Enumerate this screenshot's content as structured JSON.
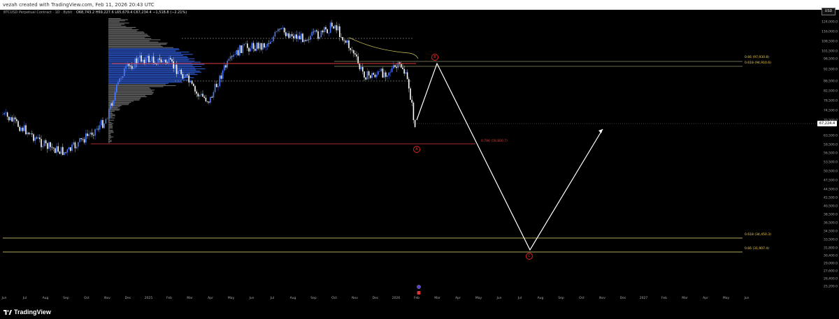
{
  "header": {
    "attribution": "vezah created with TradingView.com, Feb 11, 2026 20:43 UTC"
  },
  "symbol": {
    "name": "BTCUSD Perpetual Contract · 1D · Bybit",
    "ohlc": "O68,743.2 H69,227.6 L65,679.4 C67,234.4 −1,518.8 (−2.21%)"
  },
  "price_axis": {
    "currency": "USD",
    "current_price": "67,224.4",
    "ticks": [
      "124,000.0",
      "116,000.0",
      "108,500.0",
      "101,500.0",
      "98,500.0",
      "92,500.0",
      "86,500.0",
      "82,500.0",
      "78,500.0",
      "74,500.0",
      "70,500.0",
      "67,224.4",
      "63,500.0",
      "59,500.0",
      "56,500.0",
      "53,500.0",
      "50,500.0",
      "47,500.0",
      "44,500.0",
      "42,500.0",
      "40,500.0",
      "38,500.0",
      "36,500.0",
      "34,500.0",
      "33,500.0",
      "31,800.0",
      "30,400.0",
      "29,000.0",
      "27,600.0",
      "26,400.0",
      "25,200.0"
    ]
  },
  "time_axis": {
    "ticks": [
      "Jun",
      "Jul",
      "Aug",
      "Sep",
      "Oct",
      "Nov",
      "Dec",
      "2025",
      "Feb",
      "Mar",
      "Apr",
      "May",
      "Jun",
      "Jul",
      "Aug",
      "Sep",
      "Oct",
      "Nov",
      "Dec",
      "2026",
      "Feb",
      "Mar",
      "Apr",
      "May",
      "Jun",
      "Jul",
      "Aug",
      "Sep",
      "Oct",
      "Nov",
      "Dec",
      "2027",
      "Feb",
      "Mar",
      "Apr",
      "May",
      "Jun"
    ]
  },
  "annotations": {
    "fib_upper_1": "0.66 (97,930.8)",
    "fib_upper_2": "0.618 (94,910.6)",
    "fib_mid": "0.786 (59,800.7)",
    "fib_lower_1": "0.618 (34,450.3)",
    "fib_lower_2": "0.66 (31,907.4)",
    "wave_a": "A",
    "wave_b": "B",
    "wave_c": "C"
  },
  "footer": {
    "brand": "TradingView"
  },
  "colors": {
    "bull": "#4a7bff",
    "bear": "#ffffff",
    "fib": "#f5d142",
    "level_red": "#e03a3a",
    "projection": "#ffffff"
  }
}
